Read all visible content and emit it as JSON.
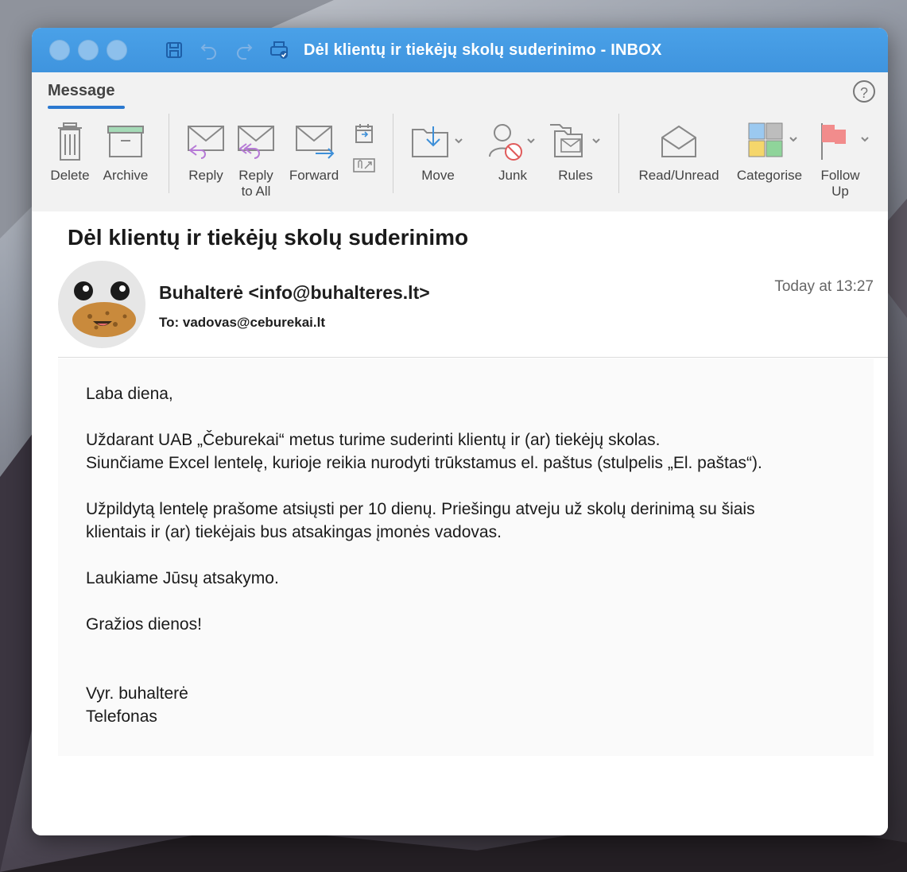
{
  "window": {
    "title": "Dėl klientų ir tiekėjų skolų suderinimo - INBOX"
  },
  "ribbon": {
    "active_tab": "Message",
    "help": "?",
    "buttons": {
      "delete": "Delete",
      "archive": "Archive",
      "reply": "Reply",
      "reply_all_1": "Reply",
      "reply_all_2": "to All",
      "forward": "Forward",
      "move": "Move",
      "junk": "Junk",
      "rules": "Rules",
      "read_unread": "Read/Unread",
      "categorise": "Categorise",
      "follow_up_1": "Follow",
      "follow_up_2": "Up"
    }
  },
  "message": {
    "subject": "Dėl klientų ir tiekėjų skolų suderinimo",
    "sender": "Buhalterė <info@buhalteres.lt>",
    "to": "To: vadovas@ceburekai.lt",
    "time": "Today at 13:27",
    "body": {
      "greeting": "Laba diena,",
      "p1_l1": "Uždarant UAB „Čeburekai“ metus turime suderinti klientų ir (ar) tiekėjų skolas.",
      "p1_l2": "Siunčiame Excel lentelę, kurioje reikia nurodyti trūkstamus el. paštus (stulpelis „El. paštas“).",
      "p2_l1": "Užpildytą lentelę prašome atsiųsti per 10 dienų. Priešingu atveju už skolų derinimą su šiais",
      "p2_l2": "klientais ir (ar) tiekėjais bus atsakingas įmonės vadovas.",
      "p3": "Laukiame Jūsų atsakymo.",
      "p4": "Gražios dienos!",
      "sig1": "Vyr. buhalterė",
      "sig2": "Telefonas"
    }
  },
  "colors": {
    "titlebar": "#4aa1e8",
    "tab_underline": "#2b79d0"
  }
}
